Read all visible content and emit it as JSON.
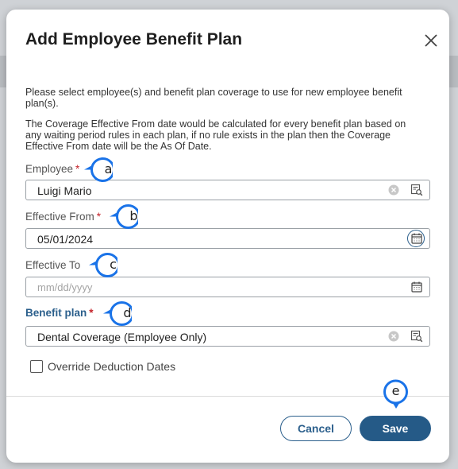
{
  "dialog": {
    "title": "Add Employee Benefit Plan",
    "description_1": "Please select employee(s) and benefit plan coverage to use for new employee benefit plan(s).",
    "description_2": "The Coverage Effective From date would be calculated for every benefit plan based on any waiting period rules in each plan, if no rule exists in the plan then the Coverage Effective From date will be the As Of Date."
  },
  "form": {
    "employee": {
      "label": "Employee",
      "required_mark": "*",
      "value": "Luigi Mario"
    },
    "effective_from": {
      "label": "Effective From",
      "required_mark": "*",
      "value": "05/01/2024"
    },
    "effective_to": {
      "label": "Effective To",
      "placeholder": "mm/dd/yyyy"
    },
    "benefit_plan": {
      "label": "Benefit plan",
      "required_mark": "*",
      "value": "Dental Coverage (Employee Only)"
    },
    "override_deduction": {
      "label": "Override Deduction Dates",
      "checked": false
    }
  },
  "footer": {
    "cancel_label": "Cancel",
    "save_label": "Save"
  },
  "callouts": [
    "a",
    "b",
    "c",
    "d",
    "e"
  ],
  "colors": {
    "accent": "#255a87",
    "required": "#c4242b",
    "callout": "#1a73e8"
  }
}
